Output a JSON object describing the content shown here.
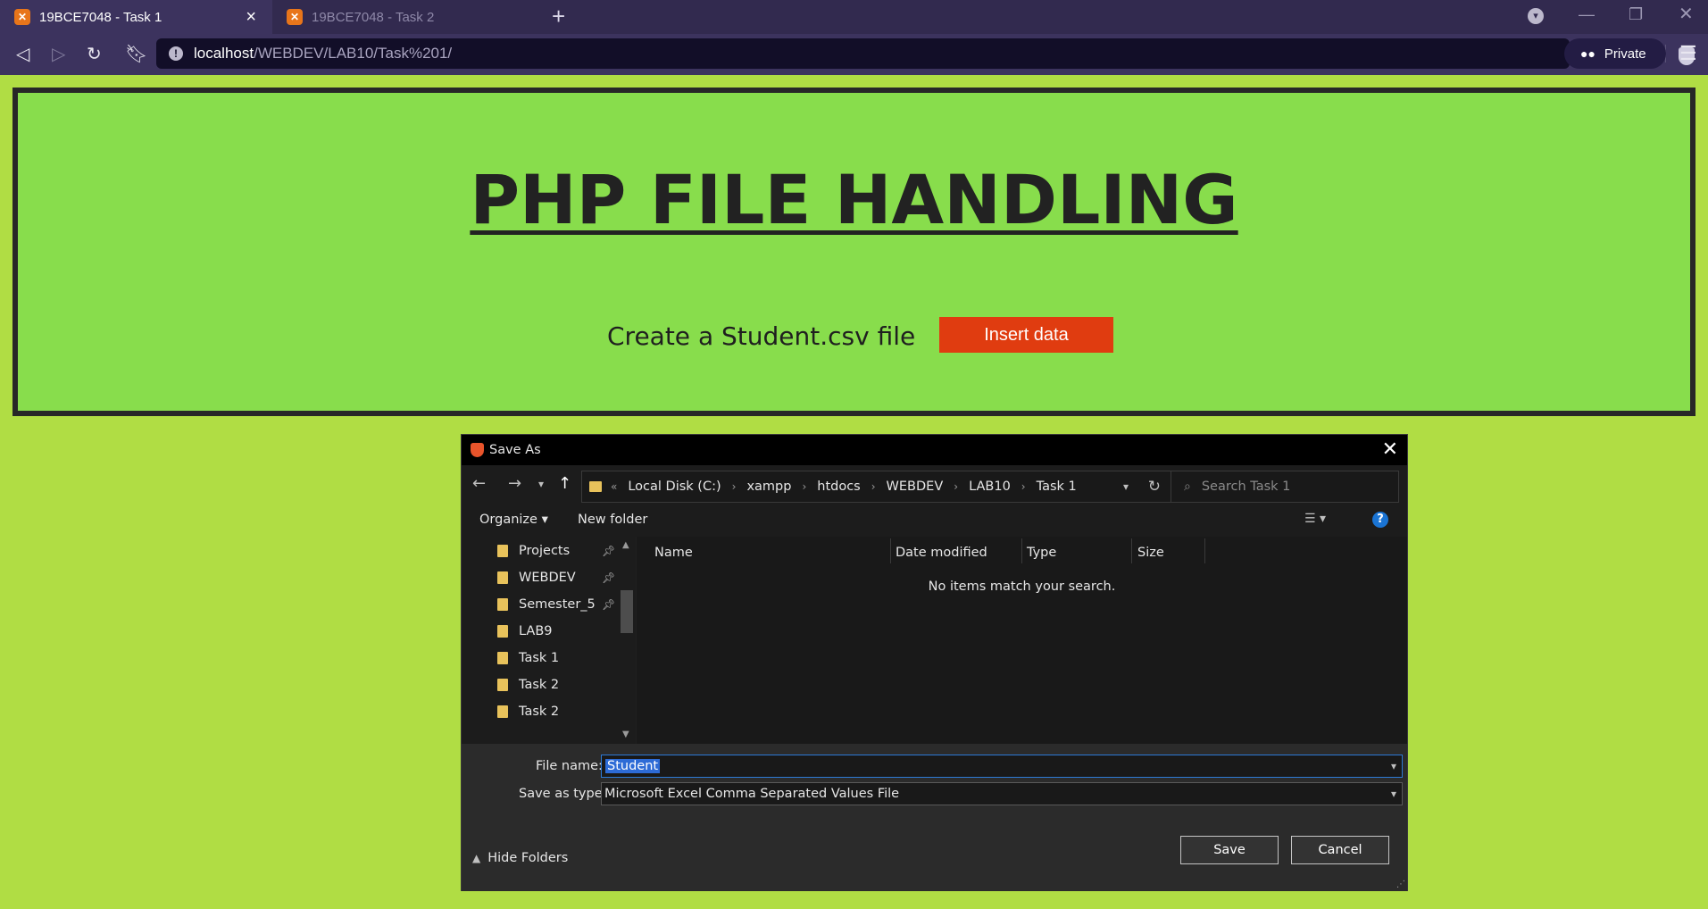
{
  "browser": {
    "tabs": [
      {
        "title": "19BCE7048 - Task 1",
        "active": true
      },
      {
        "title": "19BCE7048 - Task 2",
        "active": false
      }
    ],
    "new_tab_icon": "plus-icon",
    "url_host": "localhost",
    "url_path": "/WEBDEV/LAB10/Task%201/",
    "private_label": "Private"
  },
  "page": {
    "heading": "PHP FILE HANDLING",
    "create_label": "Create a Student.csv file",
    "insert_button": "Insert data",
    "colors": {
      "background": "#b0dd44",
      "panel": "#88dd4c",
      "button": "#e03c10"
    }
  },
  "dialog": {
    "title": "Save As",
    "breadcrumb": [
      "Local Disk (C:)",
      "xampp",
      "htdocs",
      "WEBDEV",
      "LAB10",
      "Task 1"
    ],
    "breadcrumb_prefix": "«",
    "search_placeholder": "Search Task 1",
    "organize": "Organize ▾",
    "new_folder": "New folder",
    "sidebar_items": [
      {
        "label": "Projects",
        "pinned": true
      },
      {
        "label": "WEBDEV",
        "pinned": true
      },
      {
        "label": "Semester_5",
        "pinned": true
      },
      {
        "label": "LAB9",
        "pinned": false
      },
      {
        "label": "Task 1",
        "pinned": false
      },
      {
        "label": "Task 2",
        "pinned": false
      },
      {
        "label": "Task 2",
        "pinned": false
      }
    ],
    "columns": [
      "Name",
      "Date modified",
      "Type",
      "Size"
    ],
    "empty_message": "No items match your search.",
    "file_name_label": "File name:",
    "file_name_value": "Student",
    "save_type_label": "Save as type:",
    "save_type_value": "Microsoft Excel Comma Separated Values File",
    "hide_folders": "Hide Folders",
    "save_button": "Save",
    "cancel_button": "Cancel"
  }
}
